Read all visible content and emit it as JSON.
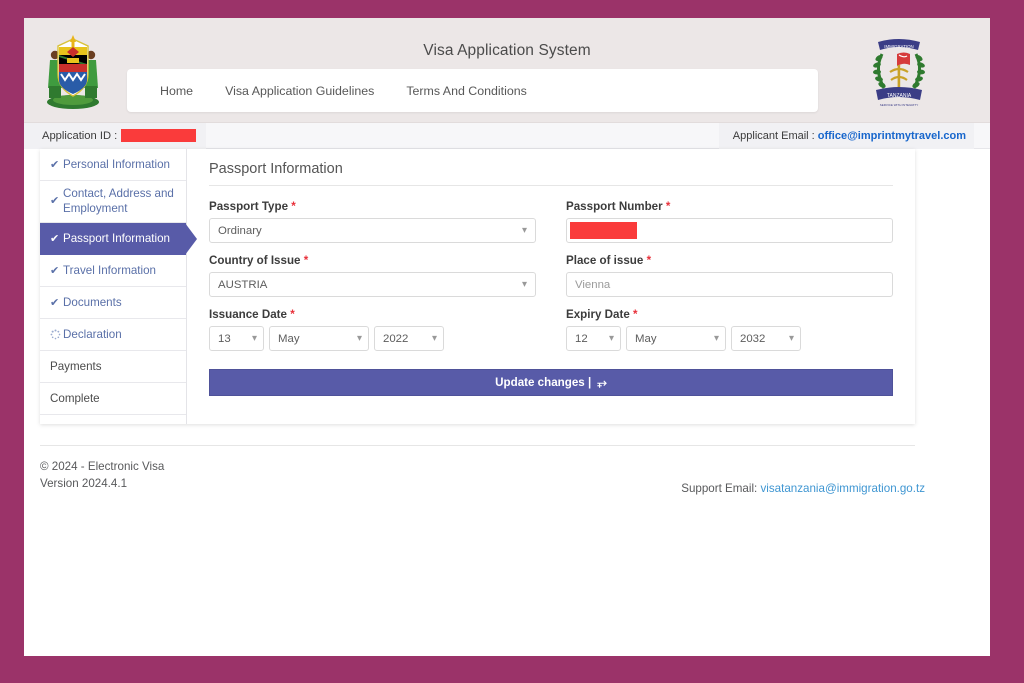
{
  "header": {
    "title": "Visa Application System",
    "left_emblem_name": "tanzania-coat-of-arms",
    "right_emblem_name": "tanzania-immigration-logo",
    "nav": [
      {
        "label": "Home"
      },
      {
        "label": "Visa Application Guidelines"
      },
      {
        "label": "Terms And Conditions"
      }
    ]
  },
  "appbar": {
    "application_id_label": "Application ID :",
    "application_id_value": "",
    "applicant_email_label": "Applicant Email :",
    "applicant_email_value": "office@imprintmytravel.com"
  },
  "sidebar": {
    "items": [
      {
        "label": "Personal Information",
        "icon": "check-icon",
        "state": "done"
      },
      {
        "label": "Contact, Address and Employment",
        "icon": "check-icon",
        "state": "done"
      },
      {
        "label": "Passport Information",
        "icon": "check-icon",
        "state": "active"
      },
      {
        "label": "Travel Information",
        "icon": "check-icon",
        "state": "done"
      },
      {
        "label": "Documents",
        "icon": "check-icon",
        "state": "done"
      },
      {
        "label": "Declaration",
        "icon": "spinner-icon",
        "state": "pending"
      },
      {
        "label": "Payments",
        "icon": "none",
        "state": "inactive"
      },
      {
        "label": "Complete",
        "icon": "none",
        "state": "inactive"
      }
    ]
  },
  "form": {
    "panel_title": "Passport Information",
    "required_marker": "*",
    "caret_icon": "chevron-down-icon",
    "passport_type": {
      "label": "Passport Type",
      "value": "Ordinary"
    },
    "passport_number": {
      "label": "Passport Number",
      "value": ""
    },
    "country_of_issue": {
      "label": "Country of Issue",
      "value": "AUSTRIA"
    },
    "place_of_issue": {
      "label": "Place of issue",
      "value": "Vienna",
      "placeholder": "Vienna"
    },
    "issuance_date": {
      "label": "Issuance Date",
      "day": "13",
      "month": "May",
      "year": "2022"
    },
    "expiry_date": {
      "label": "Expiry Date",
      "day": "12",
      "month": "May",
      "year": "2032"
    },
    "submit_label": "Update changes |",
    "submit_icon": "forward-arrow-icon"
  },
  "footer": {
    "copyright": "© 2024 - Electronic Visa",
    "version": "Version 2024.4.1",
    "support_label": "Support Email:",
    "support_email": "visatanzania@immigration.go.tz"
  },
  "colors": {
    "page_border": "#9b3369",
    "accent_purple": "#585ba8",
    "link_blue": "#1766cc",
    "required_red": "#e8313b",
    "redaction_red": "#fa3b3b",
    "header_bg": "#ece7e7"
  }
}
